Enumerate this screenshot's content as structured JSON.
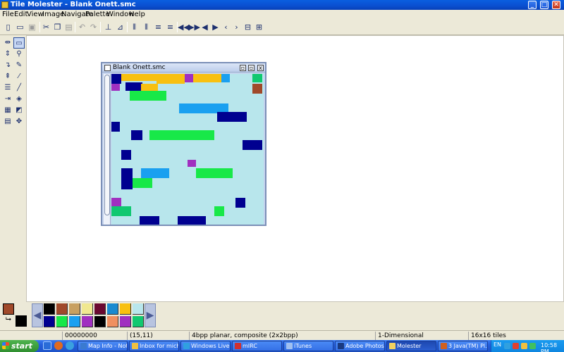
{
  "window": {
    "title": "Tile Molester - Blank Onett.smc",
    "minimize_icon": "_",
    "maximize_icon": "□",
    "close_icon": "✕"
  },
  "menu": [
    "File",
    "Edit",
    "View",
    "Image",
    "Navigate",
    "Palette",
    "Window",
    "Help"
  ],
  "toolbar": {
    "new_icon": "new-file-icon",
    "open_icon": "open-folder-icon",
    "save_icon": "save-icon",
    "cut_icon": "scissors-icon",
    "copy_icon": "copy-icon",
    "paste_icon": "paste-icon",
    "undo_icon": "undo-icon",
    "redo_icon": "redo-icon",
    "groups": [
      "decrease-cols",
      "increase-cols",
      "decrease-rows",
      "increase-rows",
      "page-back",
      "page-forward",
      "row-back",
      "row-forward",
      "tile-back",
      "tile-forward",
      "byte-back",
      "byte-forward"
    ]
  },
  "tools": [
    "move-horizontal-icon",
    "selection-icon",
    "move-vertical-icon",
    "zoom-icon",
    "shift-down-icon",
    "pencil-icon",
    "shift-up-icon",
    "eyedropper-icon",
    "tile-list-icon",
    "line-icon",
    "shift-right-icon",
    "fill-icon",
    "grid-icon",
    "replace-color-icon",
    "table-icon",
    "move-icon"
  ],
  "document": {
    "title": "Blank Onett.smc",
    "canvas_bg": "#b8e6ec"
  },
  "palette": {
    "foreground": "#a0492a",
    "background": "#000000",
    "row1": [
      "#000000",
      "#a0492a",
      "#c8a060",
      "#f0e890",
      "#6a0830",
      "#1a8ad0",
      "#f8c010",
      "#b8e6ec"
    ],
    "row2": [
      "#000090",
      "#18e848",
      "#1aa0f0",
      "#a030c0",
      "#000000",
      "#f09060",
      "#a030c0",
      "#10c870"
    ]
  },
  "status": {
    "offset": "00000000",
    "coords": "(15,11)",
    "codec": "4bpp planar, composite (2x2bpp)",
    "mode": "1-Dimensional",
    "tiles": "16x16 tiles"
  },
  "taskbar": {
    "start": "start",
    "tasks": [
      {
        "label": "Map Info - Not...",
        "color": "#3a7ad0"
      },
      {
        "label": "Inbox for micha...",
        "color": "#f0c040"
      },
      {
        "label": "Windows Live ...",
        "color": "#30a0e0"
      },
      {
        "label": "mIRC",
        "color": "#d03030"
      },
      {
        "label": "iTunes",
        "color": "#a0c0f0"
      },
      {
        "label": "Adobe Photosh...",
        "color": "#1a3a80"
      },
      {
        "label": "Molester",
        "color": "#f0d060"
      },
      {
        "label": "3 Java(TM) Pl...",
        "color": "#d06020"
      }
    ],
    "lang": "EN",
    "clock": "10:58 PM"
  }
}
